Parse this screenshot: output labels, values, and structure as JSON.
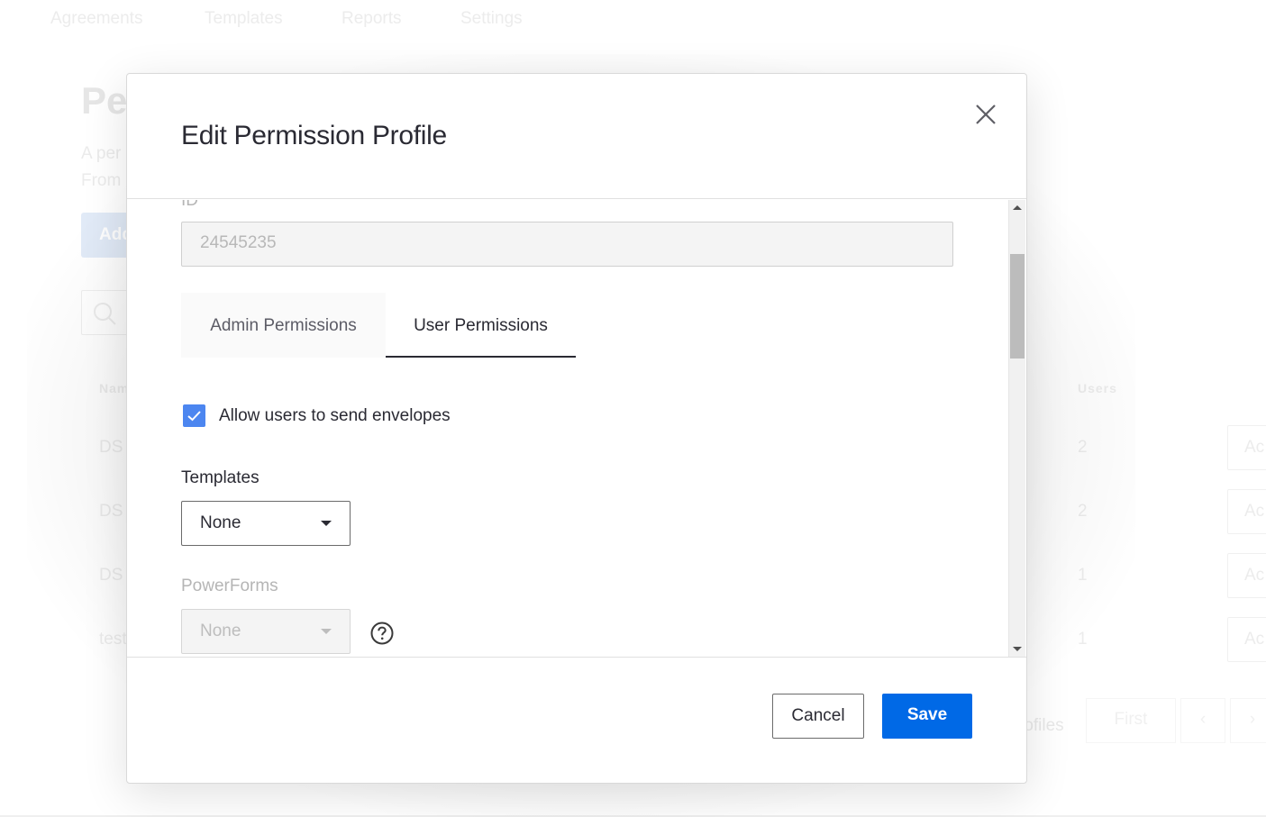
{
  "background": {
    "nav": [
      "Agreements",
      "Templates",
      "Reports",
      "Settings"
    ],
    "page_title": "Per",
    "description_lines": [
      "A per",
      "From"
    ],
    "add_button": "Add",
    "table": {
      "columns": {
        "name": "Name",
        "users": "Users"
      },
      "rows": [
        {
          "name": "DS",
          "users": "2",
          "action": "Ac"
        },
        {
          "name": "DS",
          "users": "2",
          "action": "Ac"
        },
        {
          "name": "DS",
          "users": "1",
          "action": "Ac"
        },
        {
          "name": "test",
          "users": "1",
          "action": "Ac"
        }
      ]
    },
    "pagination": {
      "profiles_label": "rofiles",
      "first": "First",
      "prev": "‹",
      "next": "›"
    }
  },
  "modal": {
    "title": "Edit Permission Profile",
    "close_icon": "close-icon",
    "id_field": {
      "label": "ID",
      "value": "24545235"
    },
    "tabs": [
      {
        "label": "Admin Permissions",
        "active": false
      },
      {
        "label": "User Permissions",
        "active": true
      }
    ],
    "allow_send": {
      "label": "Allow users to send envelopes",
      "checked": true
    },
    "templates": {
      "label": "Templates",
      "value": "None"
    },
    "powerforms": {
      "label": "PowerForms",
      "value": "None",
      "disabled": true,
      "help_icon": "question-circle-icon"
    },
    "scroll_position": 0.12,
    "footer": {
      "cancel": "Cancel",
      "save": "Save"
    }
  },
  "colors": {
    "primary": "#0069e6",
    "checkbox": "#4c86f0",
    "text": "#2a2a33"
  }
}
